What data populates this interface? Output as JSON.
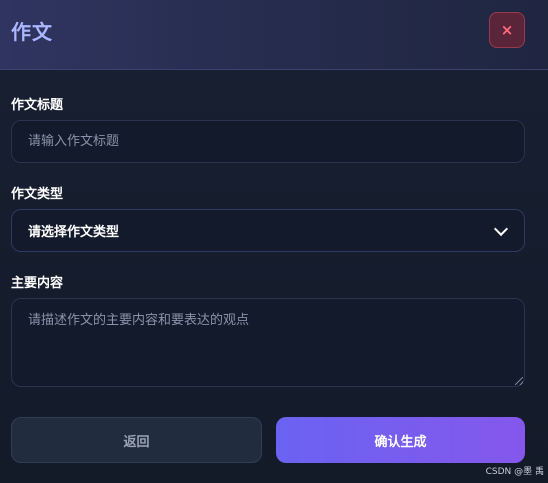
{
  "header": {
    "title": "作文",
    "close_symbol": "×"
  },
  "form": {
    "title_label": "作文标题",
    "title_placeholder": "请输入作文标题",
    "title_value": "",
    "type_label": "作文类型",
    "type_selected": "请选择作文类型",
    "content_label": "主要内容",
    "content_placeholder": "请描述作文的主要内容和要表达的观点",
    "content_value": ""
  },
  "actions": {
    "back_label": "返回",
    "confirm_label": "确认生成"
  },
  "watermark": "CSDN @墨 禹",
  "icons": {
    "close": "close-icon",
    "chevron": "chevron-down-icon",
    "resize": "resize-handle-icon"
  },
  "colors": {
    "header_title": "#aab6ff",
    "close_bg": "#5a2538",
    "close_icon": "#ff6b7e",
    "confirm_start": "#6a63f2",
    "confirm_end": "#8557ec"
  }
}
